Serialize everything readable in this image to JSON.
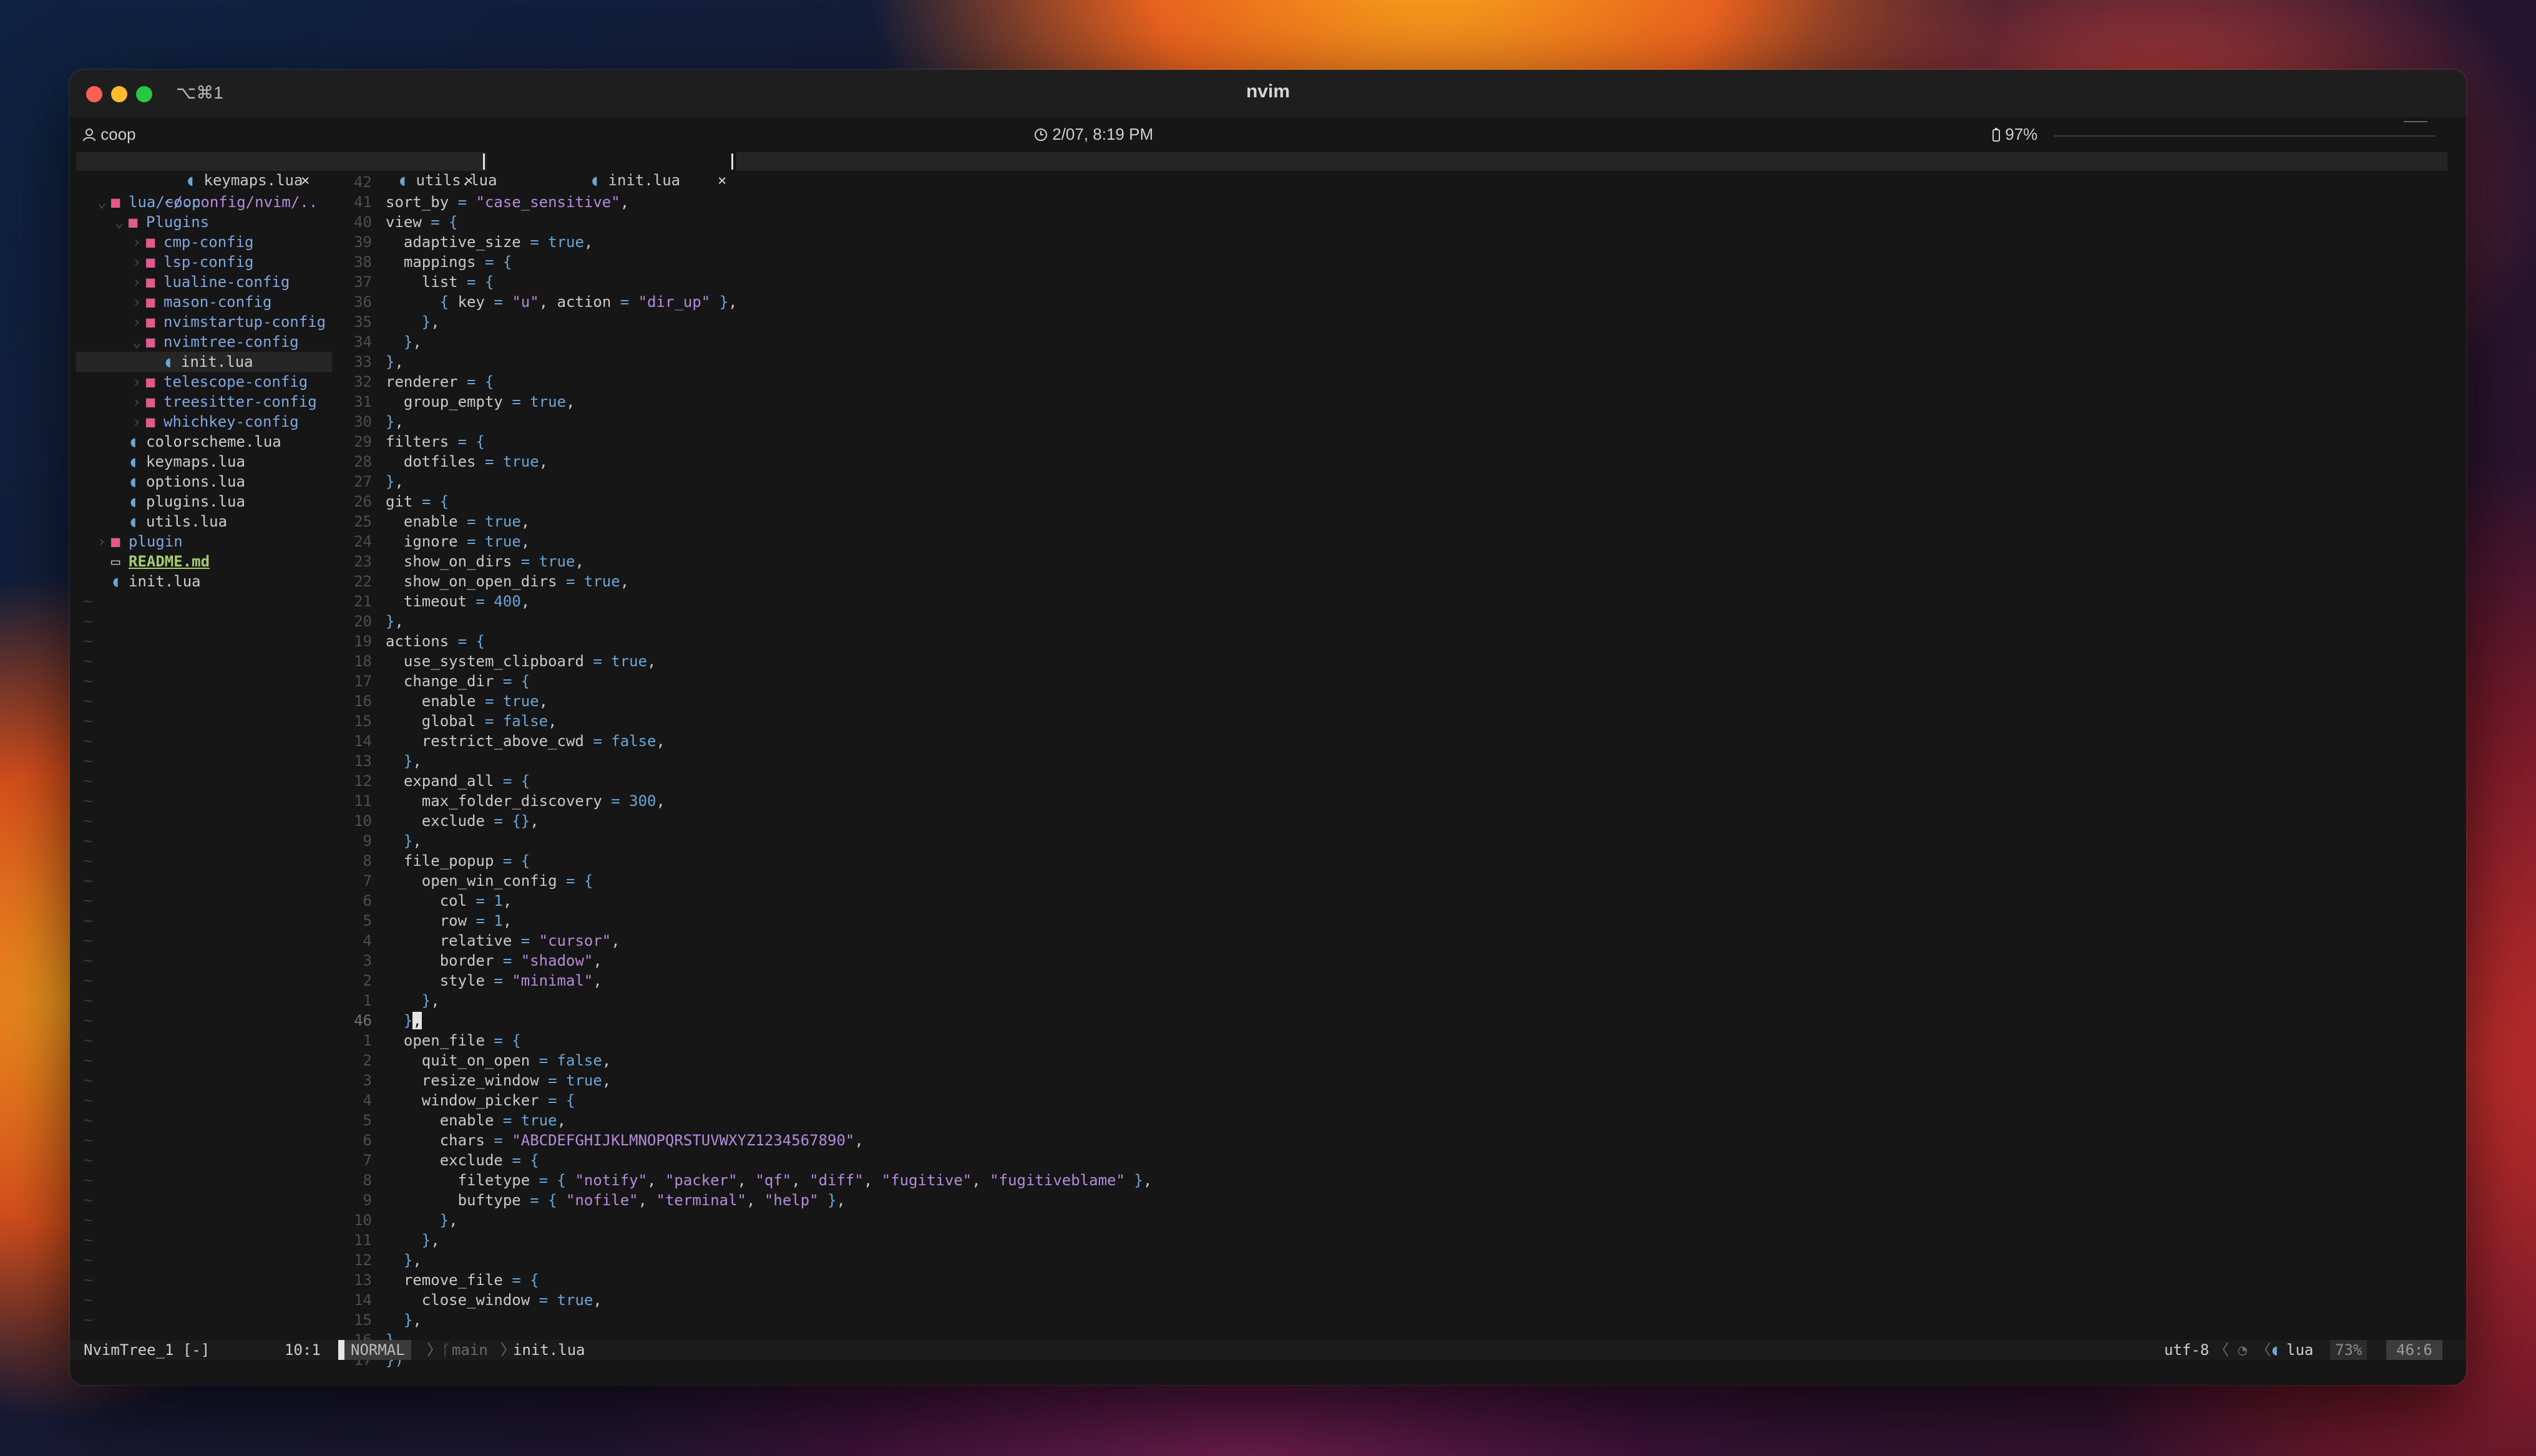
{
  "window": {
    "title": "nvim",
    "shortcut": "⌥⌘1",
    "user": "coop",
    "datetime": "2/07, 8:19 PM",
    "battery": "97%"
  },
  "tabs": [
    {
      "icon": "lua-file-icon",
      "label": "keymaps.lua",
      "close": "×"
    },
    {
      "icon": "lua-file-icon",
      "label": "utils.lua",
      "close": "×"
    },
    {
      "icon": "lua-file-icon",
      "label": "init.lua",
      "close": "×"
    }
  ],
  "tree": {
    "root": "~/.config/nvim/..",
    "items": [
      {
        "indent": 1,
        "chevron": "⌄",
        "kind": "folder",
        "label": "lua/coop"
      },
      {
        "indent": 2,
        "chevron": "⌄",
        "kind": "folder",
        "label": "Plugins"
      },
      {
        "indent": 3,
        "chevron": "›",
        "kind": "folder",
        "label": "cmp-config"
      },
      {
        "indent": 3,
        "chevron": "›",
        "kind": "folder",
        "label": "lsp-config"
      },
      {
        "indent": 3,
        "chevron": "›",
        "kind": "folder",
        "label": "lualine-config"
      },
      {
        "indent": 3,
        "chevron": "›",
        "kind": "folder",
        "label": "mason-config"
      },
      {
        "indent": 3,
        "chevron": "›",
        "kind": "folder",
        "label": "nvimstartup-config"
      },
      {
        "indent": 3,
        "chevron": "⌄",
        "kind": "folder",
        "label": "nvimtree-config"
      },
      {
        "indent": 4,
        "chevron": "",
        "kind": "file",
        "label": "init.lua",
        "selected": true
      },
      {
        "indent": 3,
        "chevron": "›",
        "kind": "folder",
        "label": "telescope-config"
      },
      {
        "indent": 3,
        "chevron": "›",
        "kind": "folder",
        "label": "treesitter-config"
      },
      {
        "indent": 3,
        "chevron": "›",
        "kind": "folder",
        "label": "whichkey-config"
      },
      {
        "indent": 2,
        "chevron": "",
        "kind": "file",
        "label": "colorscheme.lua"
      },
      {
        "indent": 2,
        "chevron": "",
        "kind": "file",
        "label": "keymaps.lua"
      },
      {
        "indent": 2,
        "chevron": "",
        "kind": "file",
        "label": "options.lua"
      },
      {
        "indent": 2,
        "chevron": "",
        "kind": "file",
        "label": "plugins.lua"
      },
      {
        "indent": 2,
        "chevron": "",
        "kind": "file",
        "label": "utils.lua"
      },
      {
        "indent": 1,
        "chevron": "›",
        "kind": "folder",
        "label": "plugin"
      },
      {
        "indent": 1,
        "chevron": "",
        "kind": "md",
        "label": "README.md"
      },
      {
        "indent": 1,
        "chevron": "",
        "kind": "file",
        "label": "init.lua"
      }
    ]
  },
  "code": [
    {
      "n": "42",
      "text": ""
    },
    {
      "n": "41",
      "text": "sort_by = \"case_sensitive\","
    },
    {
      "n": "40",
      "text": "view = {"
    },
    {
      "n": "39",
      "text": "  adaptive_size = true,"
    },
    {
      "n": "38",
      "text": "  mappings = {"
    },
    {
      "n": "37",
      "text": "    list = {"
    },
    {
      "n": "36",
      "text": "      { key = \"u\", action = \"dir_up\" },"
    },
    {
      "n": "35",
      "text": "    },"
    },
    {
      "n": "34",
      "text": "  },"
    },
    {
      "n": "33",
      "text": "},"
    },
    {
      "n": "32",
      "text": "renderer = {"
    },
    {
      "n": "31",
      "text": "  group_empty = true,"
    },
    {
      "n": "30",
      "text": "},"
    },
    {
      "n": "29",
      "text": "filters = {"
    },
    {
      "n": "28",
      "text": "  dotfiles = true,"
    },
    {
      "n": "27",
      "text": "},"
    },
    {
      "n": "26",
      "text": "git = {"
    },
    {
      "n": "25",
      "text": "  enable = true,"
    },
    {
      "n": "24",
      "text": "  ignore = true,"
    },
    {
      "n": "23",
      "text": "  show_on_dirs = true,"
    },
    {
      "n": "22",
      "text": "  show_on_open_dirs = true,"
    },
    {
      "n": "21",
      "text": "  timeout = 400,"
    },
    {
      "n": "20",
      "text": "},"
    },
    {
      "n": "19",
      "text": "actions = {"
    },
    {
      "n": "18",
      "text": "  use_system_clipboard = true,"
    },
    {
      "n": "17",
      "text": "  change_dir = {"
    },
    {
      "n": "16",
      "text": "    enable = true,"
    },
    {
      "n": "15",
      "text": "    global = false,"
    },
    {
      "n": "14",
      "text": "    restrict_above_cwd = false,"
    },
    {
      "n": "13",
      "text": "  },"
    },
    {
      "n": "12",
      "text": "  expand_all = {"
    },
    {
      "n": "11",
      "text": "    max_folder_discovery = 300,"
    },
    {
      "n": "10",
      "text": "    exclude = {},"
    },
    {
      "n": "9",
      "text": "  },"
    },
    {
      "n": "8",
      "text": "  file_popup = {"
    },
    {
      "n": "7",
      "text": "    open_win_config = {"
    },
    {
      "n": "6",
      "text": "      col = 1,"
    },
    {
      "n": "5",
      "text": "      row = 1,"
    },
    {
      "n": "4",
      "text": "      relative = \"cursor\","
    },
    {
      "n": "3",
      "text": "      border = \"shadow\","
    },
    {
      "n": "2",
      "text": "      style = \"minimal\","
    },
    {
      "n": "1",
      "text": "    },"
    },
    {
      "n": "46",
      "text": "  },",
      "current": true
    },
    {
      "n": "1",
      "text": "  open_file = {"
    },
    {
      "n": "2",
      "text": "    quit_on_open = false,"
    },
    {
      "n": "3",
      "text": "    resize_window = true,"
    },
    {
      "n": "4",
      "text": "    window_picker = {"
    },
    {
      "n": "5",
      "text": "      enable = true,"
    },
    {
      "n": "6",
      "text": "      chars = \"ABCDEFGHIJKLMNOPQRSTUVWXYZ1234567890\","
    },
    {
      "n": "7",
      "text": "      exclude = {"
    },
    {
      "n": "8",
      "text": "        filetype = { \"notify\", \"packer\", \"qf\", \"diff\", \"fugitive\", \"fugitiveblame\" },"
    },
    {
      "n": "9",
      "text": "        buftype = { \"nofile\", \"terminal\", \"help\" },"
    },
    {
      "n": "10",
      "text": "      },"
    },
    {
      "n": "11",
      "text": "    },"
    },
    {
      "n": "12",
      "text": "  },"
    },
    {
      "n": "13",
      "text": "  remove_file = {"
    },
    {
      "n": "14",
      "text": "    close_window = true,"
    },
    {
      "n": "15",
      "text": "  },"
    },
    {
      "n": "16",
      "text": "},"
    },
    {
      "n": "17",
      "text": "})"
    }
  ],
  "status": {
    "buffer": "NvimTree_1 [-]",
    "cursor_pos": "10:1",
    "mode": "NORMAL",
    "branch_icon": "branch-icon",
    "branch": "main",
    "file": "init.lua",
    "encoding": "utf-8",
    "filetype": "lua",
    "percent": "73%",
    "position": "46:6"
  },
  "colors": {
    "keyword": "#6aa6d8",
    "string": "#b58bdc",
    "folder": "#e05a8a",
    "dir": "#7fa7e0",
    "readme": "#a6cc70"
  }
}
